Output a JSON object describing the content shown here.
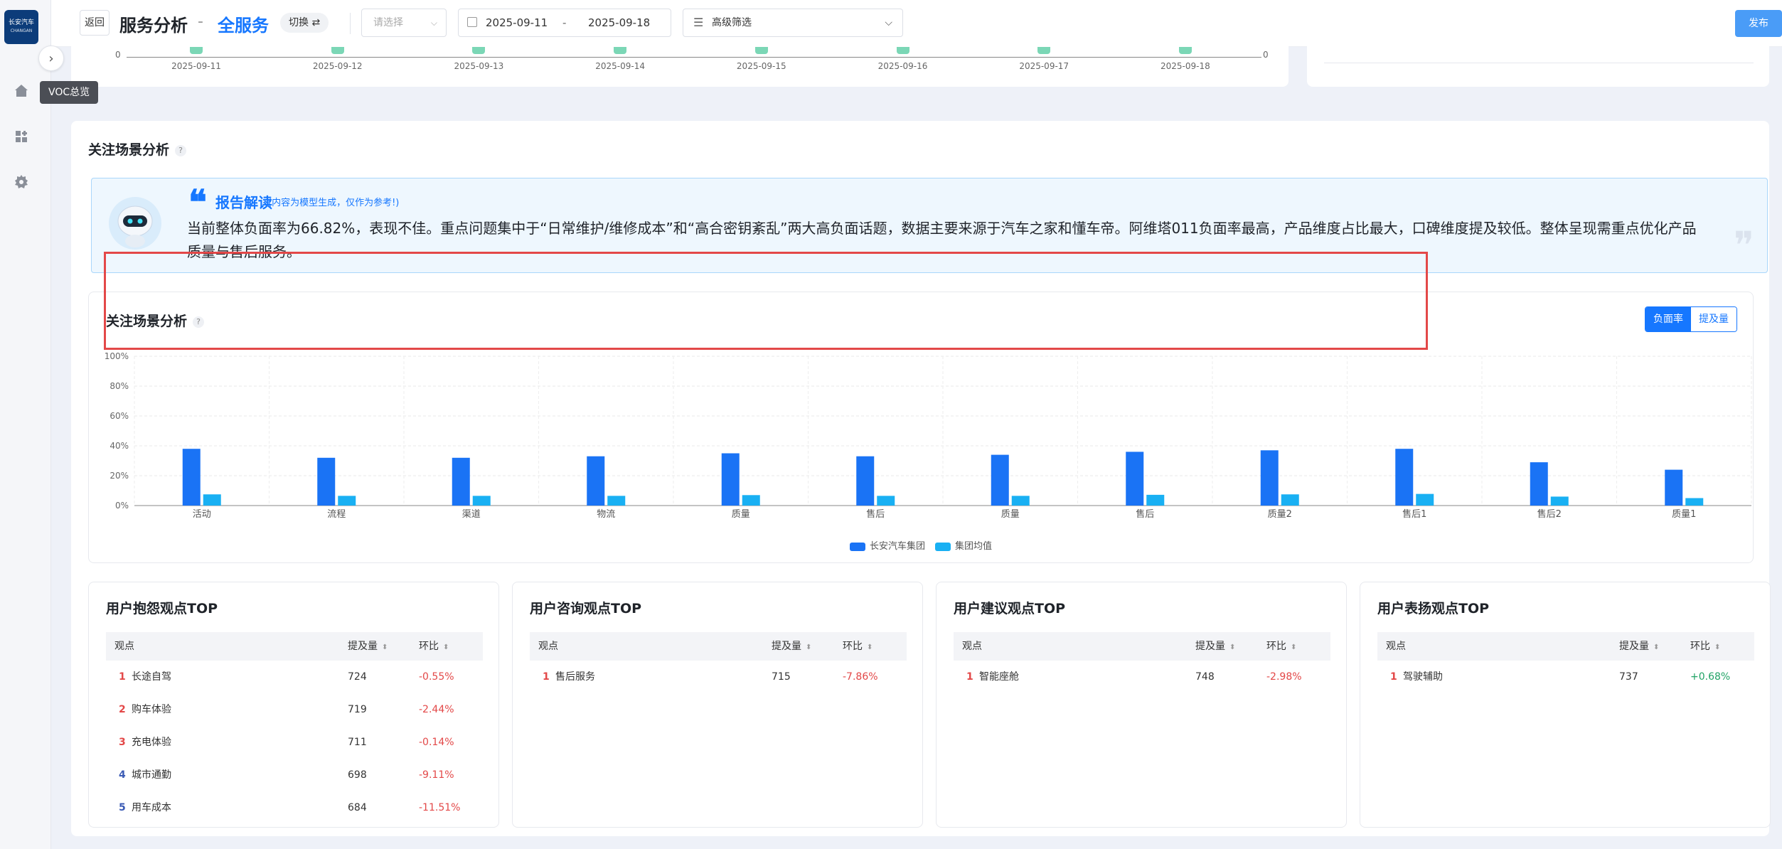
{
  "sidebar": {
    "logo_line1": "长安汽车",
    "logo_line2": "CHANGAN",
    "tooltip": "VOC总览",
    "collapse_glyph": "›",
    "icons": [
      "home-icon",
      "apps-icon",
      "gear-icon"
    ]
  },
  "header": {
    "back_label": "返回",
    "title": "服务分析",
    "sep": "-",
    "subtitle": "全服务",
    "switch_label": "切换 ⇄",
    "select_placeholder": "请选择",
    "date_start": "2025-09-11",
    "date_dash": "-",
    "date_end": "2025-09-18",
    "advanced_filter": "高级筛选",
    "publish_label": "发布"
  },
  "top_chart": {
    "zero_left": "0",
    "zero_right": "0",
    "dates": [
      "2025-09-11",
      "2025-09-12",
      "2025-09-13",
      "2025-09-14",
      "2025-09-15",
      "2025-09-16",
      "2025-09-17",
      "2025-09-18"
    ]
  },
  "section": {
    "title": "关注场景分析",
    "help": "?",
    "report": {
      "title": "报告解读",
      "note": "(内容为模型生成，仅作为参考!)",
      "text": "当前整体负面率为66.82%，表现不佳。重点问题集中于“日常维护/维修成本”和“高合密钥紊乱”两大高负面话题，数据主要来源于汽车之家和懂车帝。阿维塔011负面率最高，产品维度占比最大，口碑维度提及较低。整体呈现需重点优化产品质量与售后服务。"
    }
  },
  "chart_card": {
    "title": "关注场景分析",
    "help": "?",
    "toggle_on": "负面率",
    "toggle_off": "提及量"
  },
  "chart_data": {
    "type": "bar",
    "categories": [
      "活动",
      "流程",
      "渠道",
      "物流",
      "质量",
      "售后",
      "质量",
      "售后",
      "质量2",
      "售后1",
      "售后2",
      "质量1"
    ],
    "series": [
      {
        "name": "长安汽车集团",
        "color": "#1a73f5",
        "values": [
          38,
          32,
          32,
          33,
          35,
          33,
          34,
          36,
          37,
          38,
          29,
          24
        ]
      },
      {
        "name": "集团均值",
        "color": "#19b0f3",
        "values": [
          7.5,
          6.5,
          6.5,
          6.5,
          7,
          6.5,
          6.5,
          7.2,
          7.5,
          7.8,
          6,
          5
        ]
      }
    ],
    "yticks": [
      "0%",
      "20%",
      "40%",
      "60%",
      "80%",
      "100%"
    ],
    "ylim": [
      0,
      100
    ],
    "grid": true,
    "legend": "bottom"
  },
  "tables": [
    {
      "title": "用户抱怨观点TOP",
      "headers": [
        "观点",
        "提及量",
        "环比"
      ],
      "rows": [
        {
          "rank": "1",
          "label": "长途自驾",
          "count": "724",
          "ratio": "-0.55%"
        },
        {
          "rank": "2",
          "label": "购车体验",
          "count": "719",
          "ratio": "-2.44%"
        },
        {
          "rank": "3",
          "label": "充电体验",
          "count": "711",
          "ratio": "-0.14%"
        },
        {
          "rank": "4",
          "label": "城市通勤",
          "count": "698",
          "ratio": "-9.11%"
        },
        {
          "rank": "5",
          "label": "用车成本",
          "count": "684",
          "ratio": "-11.51%"
        }
      ]
    },
    {
      "title": "用户咨询观点TOP",
      "headers": [
        "观点",
        "提及量",
        "环比"
      ],
      "rows": [
        {
          "rank": "1",
          "label": "售后服务",
          "count": "715",
          "ratio": "-7.86%"
        }
      ]
    },
    {
      "title": "用户建议观点TOP",
      "headers": [
        "观点",
        "提及量",
        "环比"
      ],
      "rows": [
        {
          "rank": "1",
          "label": "智能座舱",
          "count": "748",
          "ratio": "-2.98%"
        }
      ]
    },
    {
      "title": "用户表扬观点TOP",
      "headers": [
        "观点",
        "提及量",
        "环比"
      ],
      "rows": [
        {
          "rank": "1",
          "label": "驾驶辅助",
          "count": "737",
          "ratio": "+0.68%"
        }
      ]
    }
  ]
}
